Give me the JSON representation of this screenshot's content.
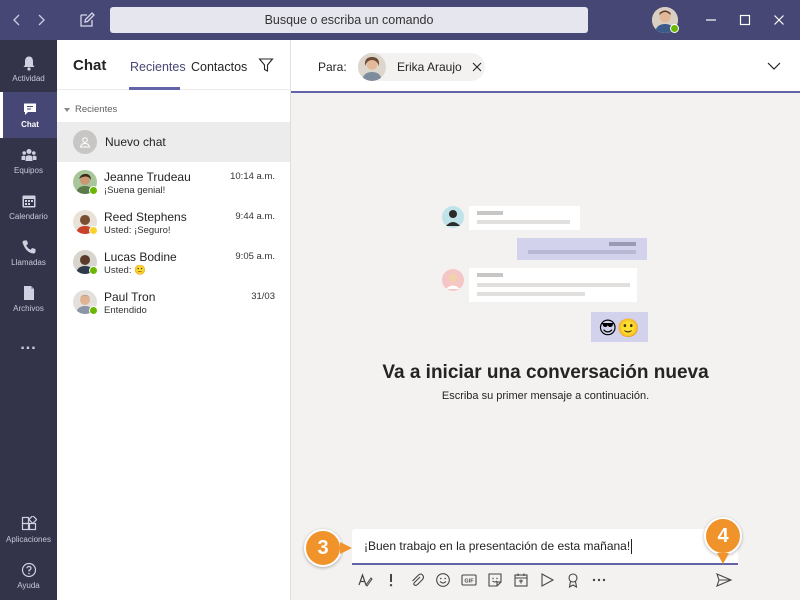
{
  "titlebar": {
    "search_placeholder": "Busque o escriba un comando",
    "back_icon": "chevron-left-icon",
    "forward_icon": "chevron-right-icon",
    "compose_icon": "compose-icon",
    "colors": {
      "bar": "#464775",
      "search": "#e6e6ee"
    }
  },
  "rail": {
    "items": [
      {
        "label": "Actividad",
        "icon": "bell-icon"
      },
      {
        "label": "Chat",
        "icon": "chat-icon",
        "active": true
      },
      {
        "label": "Equipos",
        "icon": "teams-icon"
      },
      {
        "label": "Calendario",
        "icon": "calendar-icon"
      },
      {
        "label": "Llamadas",
        "icon": "phone-icon"
      },
      {
        "label": "Archivos",
        "icon": "file-icon"
      },
      {
        "label": "...",
        "icon": "more-icon"
      },
      {
        "label": "Aplicaciones",
        "icon": "apps-icon"
      },
      {
        "label": "Ayuda",
        "icon": "help-icon"
      }
    ]
  },
  "chatlist": {
    "title": "Chat",
    "tabs": [
      {
        "label": "Recientes",
        "active": true
      },
      {
        "label": "Contactos",
        "active": false
      }
    ],
    "section": "Recientes",
    "new_chat": "Nuevo chat",
    "chats": [
      {
        "name": "Jeanne Trudeau",
        "time": "10:14 a.m.",
        "preview": "¡Suena genial!",
        "presence": "available"
      },
      {
        "name": "Reed Stephens",
        "time": "9:44 a.m.",
        "preview": "Usted: ¡Seguro!",
        "presence": "away"
      },
      {
        "name": "Lucas Bodine",
        "time": "9:05 a.m.",
        "preview": "Usted: 🙂",
        "presence": "available"
      },
      {
        "name": "Paul Tron",
        "time": "31/03",
        "preview": "Entendido",
        "presence": "available"
      }
    ]
  },
  "main": {
    "to_label": "Para:",
    "recipient": "Erika Araujo",
    "empty_title": "Va a iniciar una conversación nueva",
    "empty_subtitle": "Escriba su primer mensaje a continuación.",
    "illustration_emojis": "😎🙂",
    "compose_text": "¡Buen trabajo en la presentación de esta mañana!",
    "tools": [
      "format-icon",
      "important-icon",
      "attach-icon",
      "emoji-icon",
      "gif-icon",
      "sticker-icon",
      "meet-icon",
      "stream-icon",
      "praise-icon",
      "more-options-icon"
    ]
  },
  "steps": {
    "compose_step": "3",
    "send_step": "4"
  },
  "colors": {
    "accent": "#6264a7",
    "step_badge": "#f0932b",
    "available": "#6bb700",
    "away": "#f8d22a"
  }
}
